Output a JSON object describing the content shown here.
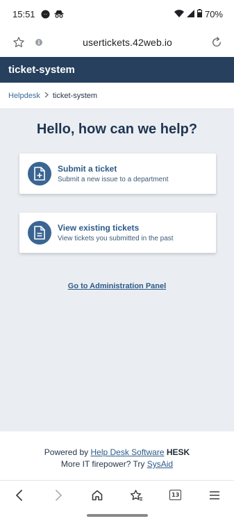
{
  "status_bar": {
    "time": "15:51",
    "battery": "70%",
    "icons": [
      "messenger-icon",
      "incognito-icon",
      "wifi-icon",
      "signal-icon",
      "battery-icon"
    ]
  },
  "browser": {
    "url": "usertickets.42web.io",
    "icons": [
      "star-icon",
      "info-icon",
      "reload-icon"
    ]
  },
  "header": {
    "title": "ticket-system"
  },
  "breadcrumb": {
    "root": "Helpdesk",
    "current": "ticket-system"
  },
  "main": {
    "heading": "Hello, how can we help?",
    "cards": [
      {
        "title": "Submit a ticket",
        "subtitle": "Submit a new issue to a department",
        "icon": "file-plus-icon"
      },
      {
        "title": "View existing tickets",
        "subtitle": "View tickets you submitted in the past",
        "icon": "file-lines-icon"
      }
    ],
    "admin_link": "Go to Administration Panel"
  },
  "footer": {
    "powered_by": "Powered by",
    "software_link": "Help Desk Software",
    "brand": "HESK",
    "more_text": "More IT firepower? Try",
    "sysaid_link": "SysAid"
  },
  "bottom_nav": {
    "tab_count": "13",
    "icons": [
      "back-icon",
      "forward-icon",
      "home-icon",
      "bookmarks-icon",
      "tabs-icon",
      "menu-icon"
    ]
  },
  "colors": {
    "header_bg": "#26405e",
    "accent": "#2d5a87",
    "icon_circle": "#3a6592",
    "page_bg": "#eaeef2"
  }
}
